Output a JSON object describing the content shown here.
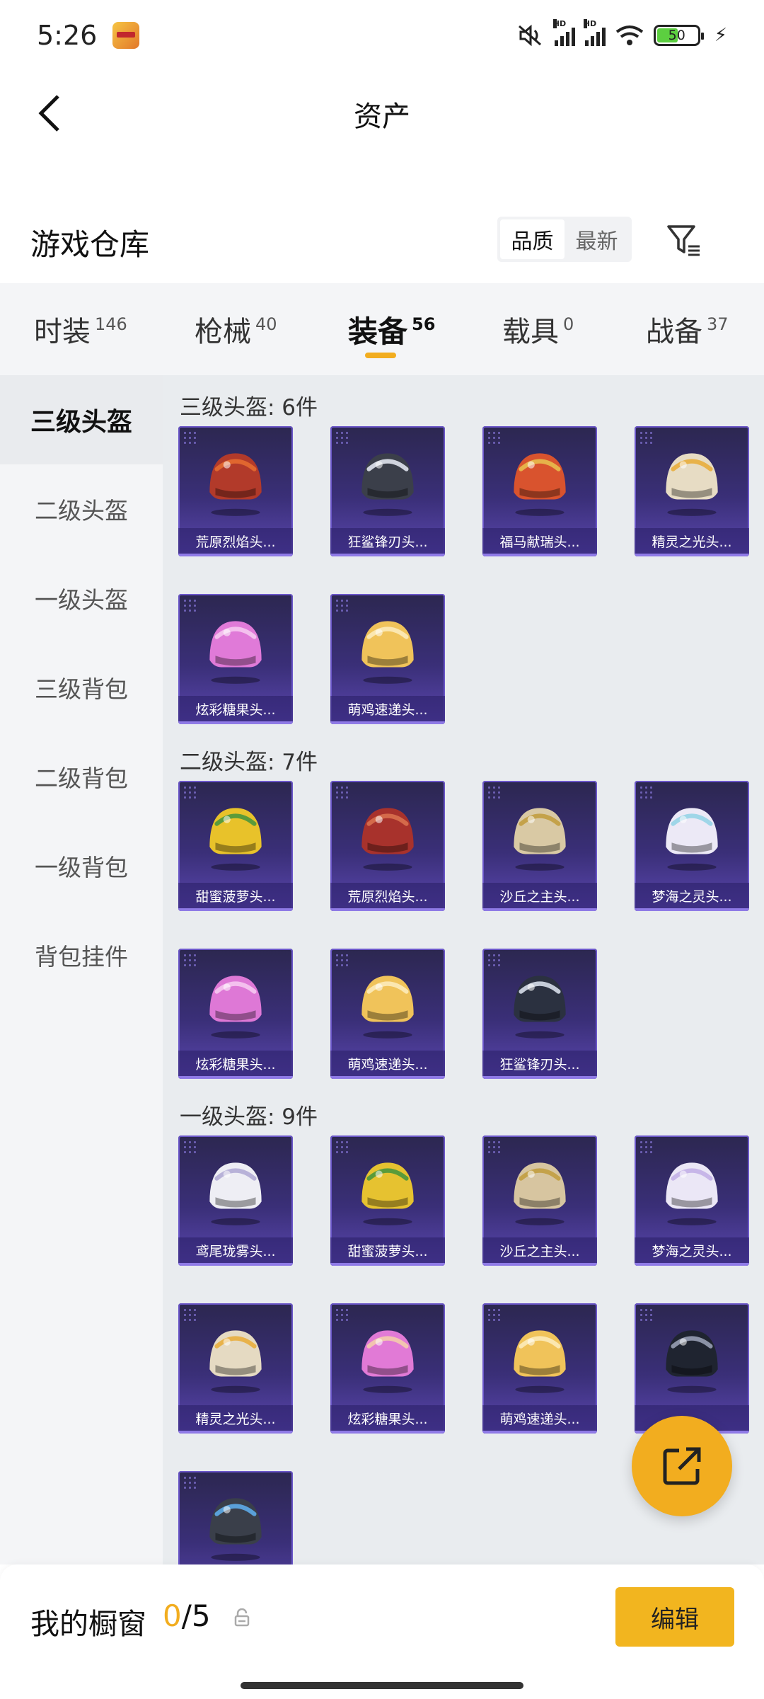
{
  "status": {
    "time": "5:26",
    "battery": "50",
    "signal1": "HD",
    "signal2": "HD"
  },
  "header": {
    "title": "资产"
  },
  "section": {
    "title": "游戏仓库",
    "sort_options": [
      "品质",
      "最新"
    ],
    "active_sort": "品质"
  },
  "tabs": [
    {
      "label": "时装",
      "count": "146"
    },
    {
      "label": "枪械",
      "count": "40"
    },
    {
      "label": "装备",
      "count": "56",
      "active": true
    },
    {
      "label": "载具",
      "count": "0"
    },
    {
      "label": "战备",
      "count": "37"
    }
  ],
  "side_nav": [
    {
      "label": "三级头盔",
      "active": true
    },
    {
      "label": "二级头盔"
    },
    {
      "label": "一级头盔"
    },
    {
      "label": "三级背包"
    },
    {
      "label": "二级背包"
    },
    {
      "label": "一级背包"
    },
    {
      "label": "背包挂件"
    }
  ],
  "groups": [
    {
      "title": "三级头盔: 6件",
      "items": [
        {
          "name": "荒原烈焰头...",
          "color": "#b23a2a",
          "accent": "#e0662f"
        },
        {
          "name": "狂鲨锋刃头...",
          "color": "#3b3f4a",
          "accent": "#d0d4de"
        },
        {
          "name": "福马献瑞头...",
          "color": "#d9532e",
          "accent": "#e6b24a"
        },
        {
          "name": "精灵之光头...",
          "color": "#e7dcc4",
          "accent": "#e8b24a"
        },
        {
          "name": "炫彩糖果头...",
          "color": "#e07ad8",
          "accent": "#f4c0ee"
        },
        {
          "name": "萌鸡速递头...",
          "color": "#f0c35a",
          "accent": "#fbe7b0"
        }
      ]
    },
    {
      "title": "二级头盔: 7件",
      "items": [
        {
          "name": "甜蜜菠萝头...",
          "color": "#e8c22a",
          "accent": "#5a9b3a"
        },
        {
          "name": "荒原烈焰头...",
          "color": "#a8322c",
          "accent": "#d46a4a"
        },
        {
          "name": "沙丘之主头...",
          "color": "#d9c9a4",
          "accent": "#c4a24a"
        },
        {
          "name": "梦海之灵头...",
          "color": "#ece9f6",
          "accent": "#9fd6e8"
        },
        {
          "name": "炫彩糖果头...",
          "color": "#de78d6",
          "accent": "#f4c0ee"
        },
        {
          "name": "萌鸡速递头...",
          "color": "#f0c35a",
          "accent": "#fbe7b0"
        },
        {
          "name": "狂鲨锋刃头...",
          "color": "#2b3140",
          "accent": "#c5ccd8"
        }
      ]
    },
    {
      "title": "一级头盔: 9件",
      "items": [
        {
          "name": "鸢尾珑雾头...",
          "color": "#eeeef4",
          "accent": "#b8b2d8"
        },
        {
          "name": "甜蜜菠萝头...",
          "color": "#e6c230",
          "accent": "#5a9b3a"
        },
        {
          "name": "沙丘之主头...",
          "color": "#d7c5a0",
          "accent": "#c4a24a"
        },
        {
          "name": "梦海之灵头...",
          "color": "#ebe7f6",
          "accent": "#c7b6e8"
        },
        {
          "name": "精灵之光头...",
          "color": "#e5dac2",
          "accent": "#e8b24a"
        },
        {
          "name": "炫彩糖果头...",
          "color": "#e17ad6",
          "accent": "#f2c4b0"
        },
        {
          "name": "萌鸡速递头...",
          "color": "#f0c35a",
          "accent": "#fbe7b0"
        },
        {
          "name": "",
          "color": "#1f2430",
          "accent": "#8b92a6"
        },
        {
          "name": "",
          "color": "#3a3f4a",
          "accent": "#5aa0d8"
        }
      ]
    }
  ],
  "bottom": {
    "showcase_label": "我的橱窗",
    "showcase_current": "0",
    "showcase_total": "/5",
    "edit_label": "编辑"
  },
  "colors": {
    "accent": "#f2ad1f",
    "card_bg": "#3a2f78"
  }
}
